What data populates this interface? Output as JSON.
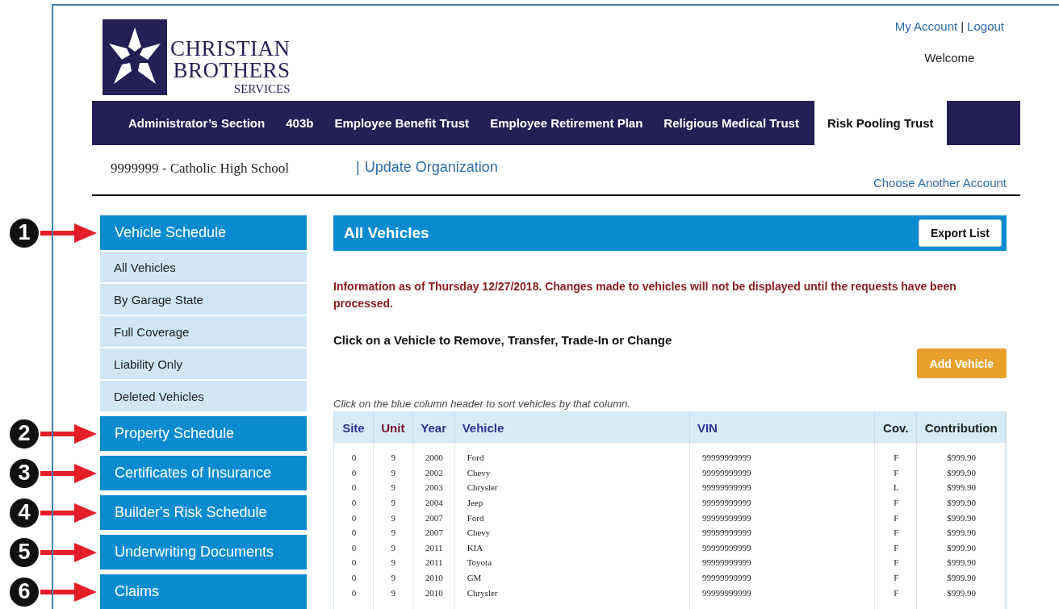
{
  "header": {
    "logo": {
      "lines": [
        "CHRISTIAN",
        "BROTHERS",
        "SERVICES"
      ]
    },
    "account_links": [
      "My Account",
      "Logout"
    ],
    "account_separator": "|",
    "welcome": "Welcome"
  },
  "nav_tabs": [
    {
      "label": "Administrator’s Section",
      "selected": false
    },
    {
      "label": "403b",
      "selected": false
    },
    {
      "label": "Employee Benefit Trust",
      "selected": false
    },
    {
      "label": "Employee Retirement Plan",
      "selected": false
    },
    {
      "label": "Religious Medical Trust",
      "selected": false
    },
    {
      "label": "Risk Pooling Trust",
      "selected": true
    }
  ],
  "organization": {
    "name": "9999999 - Catholic High School",
    "separator": "|",
    "update_link": "Update Organization",
    "choose_link": "Choose Another Account"
  },
  "sidebar": [
    {
      "label": "Vehicle Schedule",
      "callout": "1",
      "children": [
        {
          "label": "All Vehicles",
          "selected": false
        },
        {
          "label": "By Garage State",
          "selected": false
        },
        {
          "label": "Full Coverage",
          "selected": false
        },
        {
          "label": "Liability Only",
          "selected": false
        },
        {
          "label": "Deleted Vehicles",
          "selected": false
        }
      ]
    },
    {
      "label": "Property Schedule",
      "callout": "2"
    },
    {
      "label": "Certificates of Insurance",
      "callout": "3"
    },
    {
      "label": "Builder's Risk Schedule",
      "callout": "4"
    },
    {
      "label": "Underwriting Documents",
      "callout": "5"
    },
    {
      "label": "Claims",
      "callout": "6"
    }
  ],
  "main": {
    "title": "All Vehicles",
    "export_button": "Export List",
    "info": "Information as of Thursday 12/27/2018. Changes made to vehicles will not be displayed until the requests have been processed.",
    "instruction": "Click on a Vehicle to Remove, Transfer, Trade-In or Change",
    "add_button": "Add Vehicle",
    "sort_hint": "Click on the blue column header to sort vehicles by that column."
  },
  "table": {
    "columns": [
      {
        "label": "Site",
        "sortable": true,
        "selected": false
      },
      {
        "label": "Unit",
        "sortable": true,
        "selected": true
      },
      {
        "label": "Year",
        "sortable": true,
        "selected": false
      },
      {
        "label": "Vehicle",
        "sortable": true,
        "selected": false
      },
      {
        "label": "VIN",
        "sortable": true,
        "selected": false
      },
      {
        "label": "Cov.",
        "sortable": false,
        "selected": false
      },
      {
        "label": "Contribution",
        "sortable": false,
        "selected": false
      }
    ],
    "rows": [
      [
        "0",
        "9",
        "2000",
        "Ford",
        "99999999999",
        "F",
        "$999.90"
      ],
      [
        "0",
        "9",
        "2002",
        "Chevy",
        "99999999999",
        "F",
        "$999.90"
      ],
      [
        "0",
        "9",
        "2003",
        "Chrysler",
        "99999999999",
        "L",
        "$999.90"
      ],
      [
        "0",
        "9",
        "2004",
        "Jeep",
        "99999999999",
        "F",
        "$999.90"
      ],
      [
        "0",
        "9",
        "2007",
        "Ford",
        "99999999999",
        "F",
        "$999.90"
      ],
      [
        "0",
        "9",
        "2007",
        "Chevy",
        "99999999999",
        "F",
        "$999.90"
      ],
      [
        "0",
        "9",
        "2011",
        "KIA",
        "99999999999",
        "F",
        "$999.90"
      ],
      [
        "0",
        "9",
        "2011",
        "Toyota",
        "99999999999",
        "F",
        "$999.90"
      ],
      [
        "0",
        "9",
        "2010",
        "GM",
        "99999999999",
        "F",
        "$999.90"
      ],
      [
        "0",
        "9",
        "2010",
        "Chrysler",
        "99999999999",
        "F",
        "$999.90"
      ]
    ]
  }
}
